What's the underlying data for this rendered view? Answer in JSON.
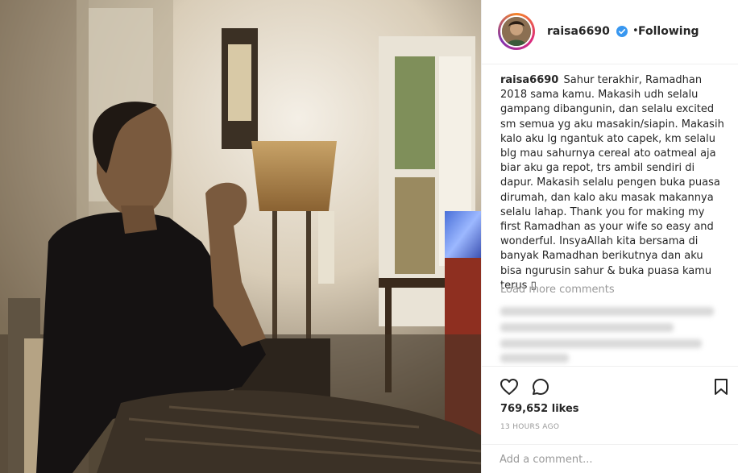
{
  "header": {
    "username": "raisa6690",
    "separator": "•",
    "follow_status": "Following"
  },
  "caption": {
    "username": "raisa6690",
    "text": "Sahur terakhir, Ramadhan 2018 sama kamu. Makasih udh selalu gampang dibangunin, dan selalu excited sm semua yg aku masakin/siapin. Makasih kalo aku lg ngantuk ato capek, km selalu blg mau sahurnya cereal ato oatmeal aja biar aku ga repot, trs ambil sendiri di dapur. Makasih selalu pengen buka puasa dirumah, dan kalo aku masak makannya selalu lahap. Thank you for making my first Ramadhan as your wife so easy and wonderful. InsyaAllah kita bersama di banyak Ramadhan berikutnya dan aku bisa ngurusin sahur & buka puasa kamu terus ▯"
  },
  "comments": {
    "load_more_label": "Load more comments"
  },
  "actions": {
    "like_icon": "heart-icon",
    "comment_icon": "comment-icon",
    "save_icon": "bookmark-icon"
  },
  "stats": {
    "likes": "769,652 likes",
    "time_ago": "13 HOURS AGO"
  },
  "comment_input": {
    "placeholder": "Add a comment..."
  },
  "colors": {
    "verified_badge": "#3897f0",
    "text_primary": "#262626",
    "text_muted": "#999999"
  }
}
